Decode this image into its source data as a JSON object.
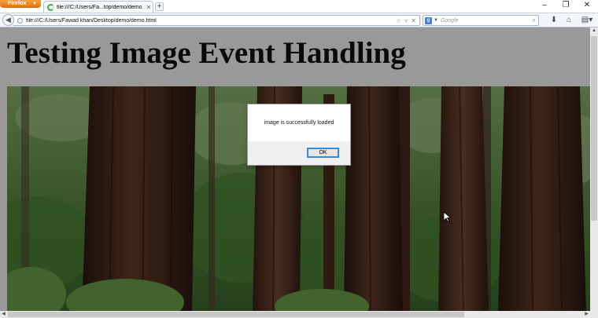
{
  "browser": {
    "menu_button_label": "Firefox",
    "tab": {
      "title": "file:///C:/Users/Fa...top/demo/demo.html"
    },
    "address_bar": {
      "url": "file:///C:/Users/Fawad khan/Desktop/demo/demo.html"
    },
    "search_bar": {
      "placeholder": "Google"
    }
  },
  "page": {
    "heading": "Testing Image Event Handling"
  },
  "alert": {
    "message": "image is successfully loaded",
    "ok_label": "OK"
  },
  "colors": {
    "firefox_orange": "#e8791e",
    "dialog_focus_border": "#3c8bd9",
    "page_overlay": "rgba(0,0,0,0.4)"
  }
}
